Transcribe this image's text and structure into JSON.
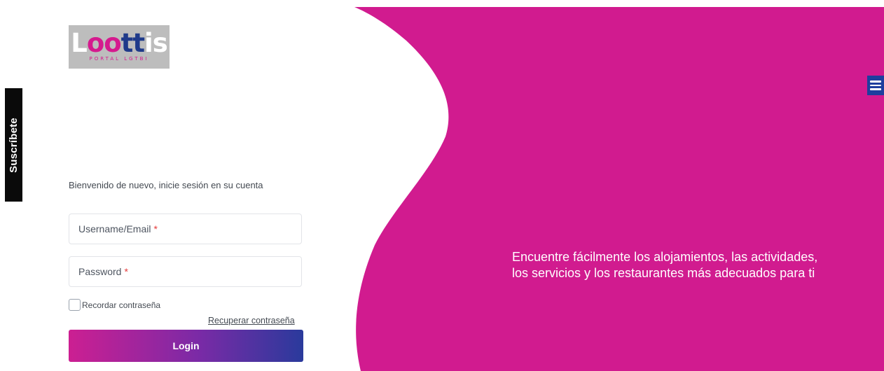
{
  "brand": {
    "logo": {
      "part_l": "L",
      "part_oo": "oo",
      "part_tt": "tt",
      "part_is": "is",
      "subtitle": "PORTAL LGTBI"
    },
    "colors": {
      "accent": "#d51a8e",
      "menu": "#1e3e9e",
      "button_start": "#cc1f92",
      "button_end": "#2a3a9c"
    }
  },
  "subscribe_tab": {
    "label": "Suscríbete"
  },
  "login": {
    "welcome": "Bienvenido de nuevo, inicie sesión en su cuenta",
    "username_placeholder": "Username/Email",
    "password_placeholder": "Password",
    "required_mark": "*",
    "remember_label": "Recordar contraseña",
    "recover_link": "Recuperar contraseña",
    "submit_label": "Login"
  },
  "promo": {
    "text": "Encuentre fácilmente los alojamientos, las actividades, los servicios y los restaurantes más adecuados para ti"
  },
  "icons": {
    "menu": "hamburger-menu-icon"
  }
}
